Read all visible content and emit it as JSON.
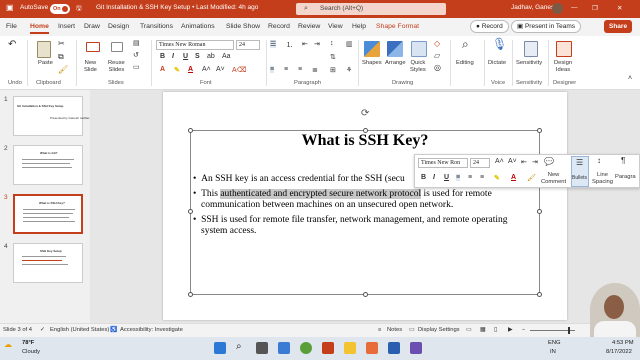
{
  "titlebar": {
    "autosave_label": "AutoSave",
    "autosave_state": "On",
    "doc_title": "Git Installation & SSH Key Setup • Last Modified: 4h ago",
    "search_placeholder": "Search (Alt+Q)",
    "user": "Jadhav, Ganesh",
    "accent": "#c43e1c"
  },
  "menu": {
    "tabs": [
      "File",
      "Home",
      "Insert",
      "Draw",
      "Design",
      "Transitions",
      "Animations",
      "Slide Show",
      "Record",
      "Review",
      "View",
      "Help",
      "Shape Format"
    ],
    "active": "Home",
    "record_label": "Record",
    "present_label": "Present in Teams",
    "share_label": "Share"
  },
  "ribbon": {
    "groups": {
      "undo": "Undo",
      "clipboard": "Clipboard",
      "slides": "Slides",
      "font": "Font",
      "paragraph": "Paragraph",
      "drawing": "Drawing",
      "voice": "Voice",
      "sensitivity": "Sensitivity",
      "designer": "Designer"
    },
    "buttons": {
      "paste": "Paste",
      "new_slide": [
        "New",
        "Slide"
      ],
      "reuse_slides": [
        "Reuse",
        "Slides"
      ],
      "shapes": "Shapes",
      "arrange": "Arrange",
      "quick_styles": [
        "Quick",
        "Styles"
      ],
      "editing": "Editing",
      "dictate": "Dictate",
      "sensitivity": "Sensitivity",
      "design_ideas": [
        "Design",
        "Ideas"
      ]
    },
    "font_name": "Times New Roman",
    "font_size": "24"
  },
  "thumbnails": [
    {
      "num": "1",
      "title": "Git Installation & SSH Key Setup",
      "sub": "Presented by Ganesh Jadhav"
    },
    {
      "num": "2",
      "title": "What is Git?"
    },
    {
      "num": "3",
      "title": "What is SSH Key?"
    },
    {
      "num": "4",
      "title": "SSH Key Setup"
    }
  ],
  "slide": {
    "title": "What is SSH Key?",
    "bullets": [
      {
        "lines": [
          "An SSH key is an access credential for the SSH (secu"
        ]
      },
      {
        "pre": "This ",
        "hl": "authenticated and encrypted secure network protocol",
        "post": " is used for remote",
        "line2": "communication between machines on an unsecured open network."
      },
      {
        "lines": [
          "SSH is used for remote file transfer, network management, and remote operating",
          "system access."
        ]
      }
    ]
  },
  "mini_toolbar": {
    "font": "Times New Ron",
    "size": "24",
    "new_comment": [
      "New",
      "Comment"
    ],
    "bullets": "Bullets",
    "line_spacing": [
      "Line",
      "Spacing"
    ],
    "paragraph": "Paragra"
  },
  "status": {
    "slide": "Slide 3 of 4",
    "language": "English (United States)",
    "accessibility": "Accessibility: Investigate",
    "notes": "Notes",
    "display": "Display Settings"
  },
  "taskbar": {
    "weather_temp": "78°F",
    "weather_desc": "Cloudy",
    "lang": "ENG",
    "region": "IN",
    "time": "4:53 PM",
    "date": "8/17/2022"
  }
}
